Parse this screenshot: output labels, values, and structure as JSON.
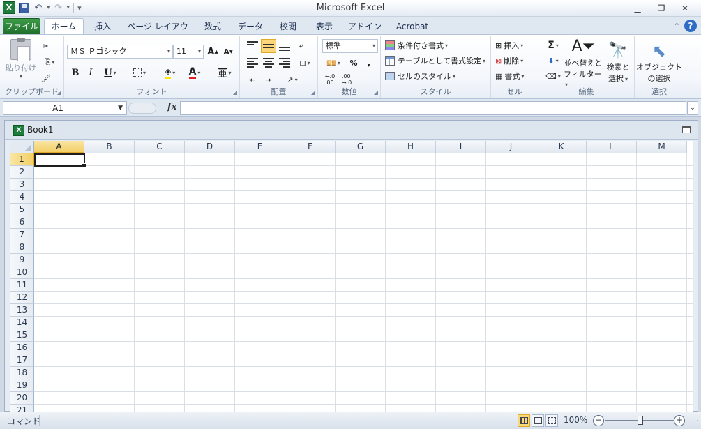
{
  "window": {
    "title": "Microsoft Excel",
    "app_icon_letter": "X",
    "controls": [
      "minimize-button",
      "restore-button",
      "close-button"
    ]
  },
  "ribbon_tabs": [
    {
      "label": "ファイル",
      "name": "tab-file"
    },
    {
      "label": "ホーム",
      "name": "tab-home",
      "active": true
    },
    {
      "label": "挿入",
      "name": "tab-insert"
    },
    {
      "label": "ページ レイアウト",
      "name": "tab-page-layout"
    },
    {
      "label": "数式",
      "name": "tab-formulas"
    },
    {
      "label": "データ",
      "name": "tab-data"
    },
    {
      "label": "校閲",
      "name": "tab-review"
    },
    {
      "label": "表示",
      "name": "tab-view"
    },
    {
      "label": "アドイン",
      "name": "tab-addins"
    },
    {
      "label": "Acrobat",
      "name": "tab-acrobat"
    }
  ],
  "clipboard": {
    "paste_label": "貼り付け",
    "group_label": "クリップボード"
  },
  "font": {
    "font_name": "ＭＳ Ｐゴシック",
    "font_size": "11",
    "bold": "B",
    "italic": "I",
    "underline": "U",
    "font_color_letter": "A",
    "phonetic_letter": "亜",
    "group_label": "フォント"
  },
  "alignment": {
    "group_label": "配置"
  },
  "number": {
    "format": "標準",
    "percent": "%",
    "comma": ",",
    "group_label": "数値"
  },
  "styles": {
    "conditional_formatting": "条件付き書式",
    "format_as_table": "テーブルとして書式設定",
    "cell_styles": "セルのスタイル",
    "group_label": "スタイル"
  },
  "cells": {
    "insert": "挿入",
    "delete": "削除",
    "format": "書式",
    "group_label": "セル"
  },
  "editing": {
    "sort_filter_line1": "並べ替えと",
    "sort_filter_line2": "フィルター",
    "find_select_line1": "検索と",
    "find_select_line2": "選択",
    "group_label": "編集"
  },
  "selection": {
    "select_objects_line1": "オブジェクト",
    "select_objects_line2": "の選択",
    "group_label": "選択"
  },
  "formula_bar": {
    "name_box": "A1",
    "fx": "fx",
    "formula": ""
  },
  "workbook": {
    "name": "Book1"
  },
  "sheet": {
    "columns": [
      "A",
      "B",
      "C",
      "D",
      "E",
      "F",
      "G",
      "H",
      "I",
      "J",
      "K",
      "L",
      "M"
    ],
    "rows": [
      "1",
      "2",
      "3",
      "4",
      "5",
      "6",
      "7",
      "8",
      "9",
      "10",
      "11",
      "12",
      "13",
      "14",
      "15",
      "16",
      "17",
      "18",
      "19",
      "20",
      "21"
    ],
    "active_cell": "A1"
  },
  "status_bar": {
    "mode": "コマンド",
    "zoom": "100%",
    "zoom_fraction": 0.5
  },
  "colors": {
    "file_tab": "#1e6e2a",
    "selection_header": "#f3cf66",
    "grid_line": "#dadfe6"
  }
}
